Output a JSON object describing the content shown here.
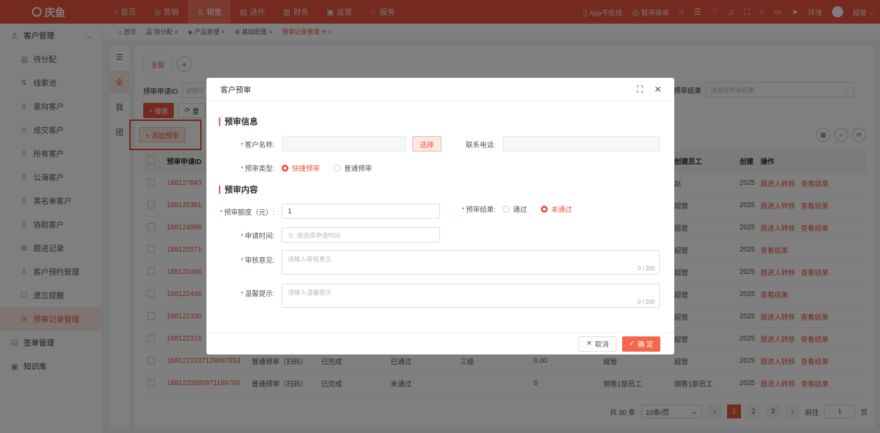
{
  "app": {
    "logo": "庆鱼"
  },
  "topnav": [
    {
      "icon": "⌂",
      "label": "首页"
    },
    {
      "icon": "◎",
      "label": "营销"
    },
    {
      "icon": "♙",
      "label": "销售"
    },
    {
      "icon": "▤",
      "label": "进件"
    },
    {
      "icon": "▥",
      "label": "财务"
    },
    {
      "icon": "▣",
      "label": "运营"
    },
    {
      "icon": "♘",
      "label": "服务"
    }
  ],
  "topright": {
    "app_status": "App不在线",
    "pause": "暂停接单",
    "env": "环境",
    "user": "超管"
  },
  "sidebar": {
    "group1": "客户管理",
    "items": [
      {
        "icon": "品",
        "label": "待分配"
      },
      {
        "icon": "⇅",
        "label": "线索池"
      },
      {
        "icon": "♙",
        "label": "意向客户"
      },
      {
        "icon": "♙",
        "label": "成交客户"
      },
      {
        "icon": "♙",
        "label": "所有客户"
      },
      {
        "icon": "♙",
        "label": "公海客户"
      },
      {
        "icon": "♙",
        "label": "黑名单客户"
      },
      {
        "icon": "♙",
        "label": "协助客户"
      },
      {
        "icon": "▤",
        "label": "跟进记录"
      },
      {
        "icon": "♙",
        "label": "客户预约管理"
      },
      {
        "icon": "☐",
        "label": "遗忘提醒"
      },
      {
        "icon": "◷",
        "label": "预审记录管理"
      }
    ],
    "group2": "签单管理",
    "group3": "知识库"
  },
  "tabs": [
    {
      "label": "首页"
    },
    {
      "label": "待分配 ×"
    },
    {
      "label": "产品管理 ×"
    },
    {
      "label": "基础配置 ×"
    },
    {
      "label": "预审记录管理 ⟳ ×"
    }
  ],
  "strip": {
    "all": "全",
    "mine": "我",
    "team": "团"
  },
  "content": {
    "chip_all": "全部",
    "filter_label": "预审申请ID",
    "filter_placeholder": "请填写",
    "result_label": "预审结果",
    "result_placeholder": "请选择预审结果",
    "search_btn": "搜索",
    "reset_btn": "重",
    "add_btn": "+ 添加预审"
  },
  "table": {
    "headers": {
      "id": "预审申请ID",
      "creator": "创建员工",
      "date": "创建",
      "op": "操作"
    },
    "rows": [
      {
        "id": "188127843",
        "type": "",
        "status": "",
        "result": "",
        "level": "",
        "amount": "",
        "creator": "",
        "emp": "赵",
        "date": "2025",
        "ops": [
          "跟进人转移",
          "查看结果"
        ]
      },
      {
        "id": "188125381",
        "type": "",
        "status": "",
        "result": "",
        "level": "",
        "amount": "",
        "creator": "",
        "emp": "超管",
        "date": "2025",
        "ops": [
          "跟进人转移",
          "查看结果"
        ]
      },
      {
        "id": "188124896",
        "type": "",
        "status": "",
        "result": "",
        "level": "",
        "amount": "",
        "creator": "",
        "emp": "超管",
        "date": "2025",
        "ops": [
          "跟进人转移",
          "查看结果"
        ]
      },
      {
        "id": "188122571",
        "type": "",
        "status": "",
        "result": "",
        "level": "",
        "amount": "",
        "creator": "",
        "emp": "超管",
        "date": "2025",
        "ops": [
          "查看结果"
        ]
      },
      {
        "id": "188122466",
        "type": "",
        "status": "",
        "result": "",
        "level": "",
        "amount": "",
        "creator": "",
        "emp": "超管",
        "date": "2025",
        "ops": [
          "跟进人转移",
          "查看结果"
        ]
      },
      {
        "id": "188122446",
        "type": "",
        "status": "",
        "result": "",
        "level": "",
        "amount": "",
        "creator": "",
        "emp": "超管",
        "date": "2025",
        "ops": [
          "查看结果"
        ]
      },
      {
        "id": "188122330",
        "type": "",
        "status": "",
        "result": "",
        "level": "",
        "amount": "",
        "creator": "",
        "emp": "超管",
        "date": "2025",
        "ops": [
          "跟进人转移",
          "查看结果"
        ]
      },
      {
        "id": "188122316",
        "type": "",
        "status": "",
        "result": "",
        "level": "",
        "amount": "",
        "creator": "",
        "emp": "超管",
        "date": "2025",
        "ops": [
          "跟进人转移",
          "查看结果"
        ]
      },
      {
        "id": "1881221537128087553",
        "type": "普通预审（扫码）",
        "status": "已完成",
        "result": "已通过",
        "level": "三级",
        "amount": "0.00",
        "creator": "超管",
        "emp": "超管",
        "date": "2025",
        "ops": [
          "跟进人转移",
          "查看结果"
        ]
      },
      {
        "id": "1881220880971169793",
        "type": "普通预审（扫码）",
        "status": "已完成",
        "result": "未通过",
        "level": "",
        "amount": "0",
        "creator": "销售1部员工",
        "emp": "销售1部员工",
        "date": "2025",
        "ops": [
          "跟进人转移",
          "查看结果"
        ]
      }
    ]
  },
  "pager": {
    "total": "共 30 条",
    "size": "10条/页",
    "pages": [
      "1",
      "2",
      "3"
    ],
    "goto_label": "前往",
    "goto_value": "1",
    "page_unit": "页"
  },
  "modal": {
    "title": "客户预审",
    "section1": "预审信息",
    "customer_label": "客户名称:",
    "select_btn": "选择",
    "phone_label": "联系电话:",
    "type_label": "预审类型:",
    "type_opt1": "快捷预审",
    "type_opt2": "普通预审",
    "section2": "预审内容",
    "amount_label": "预审额度（元）:",
    "amount_value": "1",
    "result_label": "预审结果:",
    "result_opt1": "通过",
    "result_opt2": "未通过",
    "time_label": "申请时间:",
    "time_placeholder": "请选择申请时间",
    "opinion_label": "审核意见:",
    "opinion_placeholder": "请输入审核意见",
    "opinion_count": "0 / 200",
    "tip_label": "温馨提示:",
    "tip_placeholder": "请输入温馨提示",
    "tip_count": "0 / 200",
    "cancel": "取消",
    "ok": "确 定"
  }
}
